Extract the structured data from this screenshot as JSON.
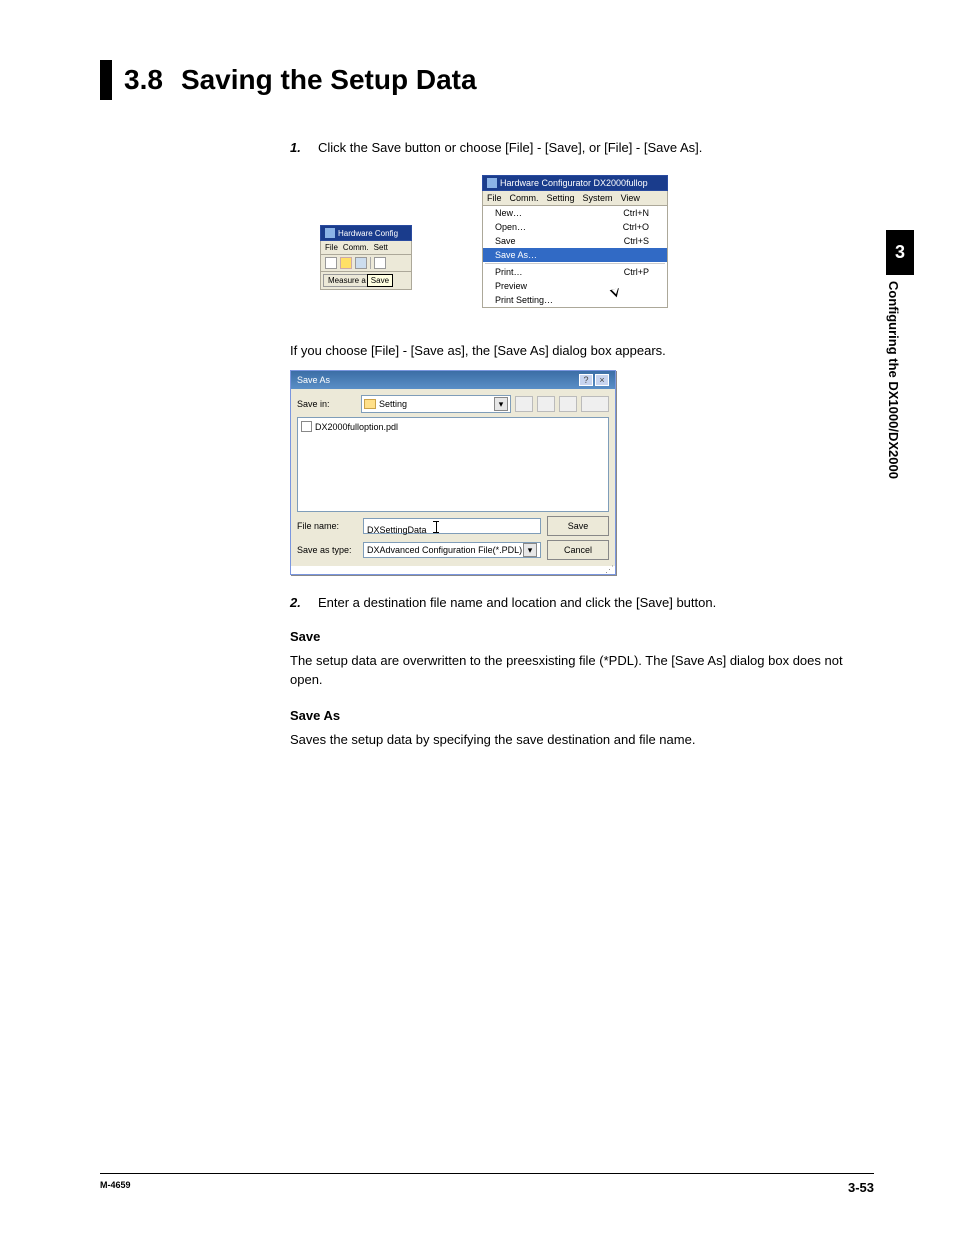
{
  "heading": {
    "num": "3.8",
    "title": "Saving the Setup Data"
  },
  "side": {
    "chapter": "3",
    "text": "Configuring the DX1000/DX2000"
  },
  "steps": {
    "one_num": "1.",
    "one": "Click the Save button or choose [File] - [Save], or [File] - [Save As].",
    "two_num": "2.",
    "two": "Enter a destination file name and location and click the [Save] button."
  },
  "para_between": "If you choose [File] - [Save as], the [Save As] dialog box appears.",
  "save_head": "Save",
  "save_body": "The setup data are overwritten to the preesxisting file (*PDL).  The [Save As] dialog box does not open.",
  "saveas_head": "Save As",
  "saveas_body": "Saves the setup data by specifying the save destination and file name.",
  "fig1": {
    "title": "Hardware Config",
    "menu": {
      "file": "File",
      "comm": "Comm.",
      "sett": "Sett"
    },
    "measure_tab": "Measure a",
    "tooltip": "Save"
  },
  "fig2": {
    "title": "Hardware Configurator DX2000fullop",
    "menu": {
      "file": "File",
      "comm": "Comm.",
      "setting": "Setting",
      "system": "System",
      "view": "View"
    },
    "items": {
      "new": "New…",
      "new_sc": "Ctrl+N",
      "open": "Open…",
      "open_sc": "Ctrl+O",
      "save": "Save",
      "save_sc": "Ctrl+S",
      "saveas": "Save As…",
      "print": "Print…",
      "print_sc": "Ctrl+P",
      "preview": "Preview",
      "printsetting": "Print Setting…"
    }
  },
  "saveas_dialog": {
    "title": "Save As",
    "help": "?",
    "close": "×",
    "savein_label": "Save in:",
    "savein_folder": "Setting",
    "file_item": "DX2000fulloption.pdl",
    "filename_label": "File name:",
    "filename_value": "DXSettingData",
    "savetype_label": "Save as type:",
    "savetype_value": "DXAdvanced Configuration File(*.PDL)",
    "save_btn": "Save",
    "cancel_btn": "Cancel"
  },
  "footer": {
    "left": "M-4659",
    "right": "3-53"
  }
}
